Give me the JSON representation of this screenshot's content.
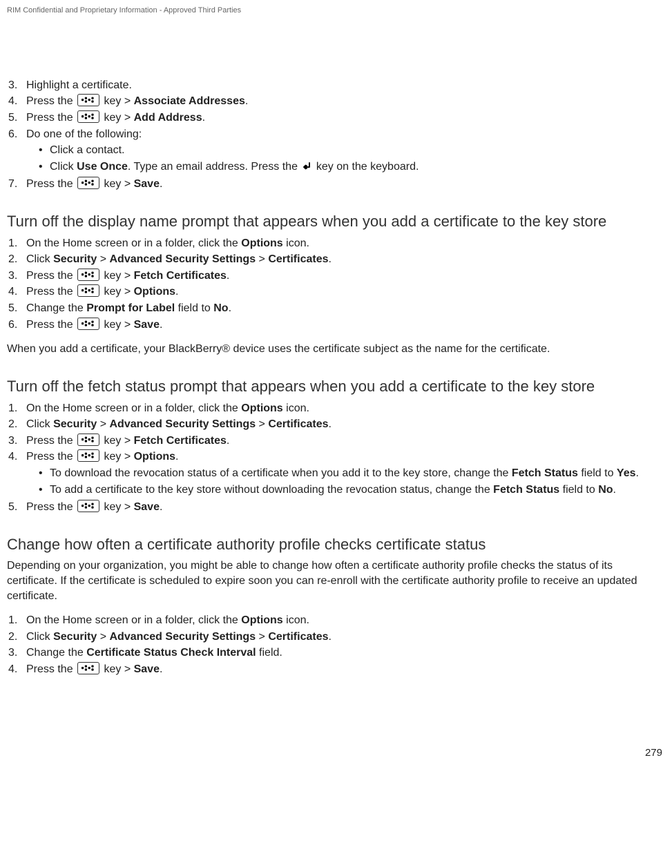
{
  "header": {
    "confidential": "RIM Confidential and Proprietary Information - Approved Third Parties"
  },
  "intro_list": {
    "i3": {
      "num": "3.",
      "text": "Highlight a certificate."
    },
    "i4": {
      "num": "4.",
      "pre": "Press the ",
      "post": " key > ",
      "bold": "Associate Addresses",
      "tail": "."
    },
    "i5": {
      "num": "5.",
      "pre": "Press the ",
      "post": " key > ",
      "bold": "Add Address",
      "tail": "."
    },
    "i6": {
      "num": "6.",
      "text": "Do one of the following:",
      "b1": "Click a contact.",
      "b2_pre": "Click ",
      "b2_bold": "Use Once",
      "b2_mid": ". Type an email address. Press the ",
      "b2_post": " key on the keyboard."
    },
    "i7": {
      "num": "7.",
      "pre": "Press the ",
      "post": " key > ",
      "bold": "Save",
      "tail": "."
    }
  },
  "sec1": {
    "title": "Turn off the display name prompt that appears when you add a certificate to the key store",
    "s1": {
      "num": "1.",
      "pre": "On the Home screen or in a folder, click the ",
      "bold": "Options",
      "tail": " icon."
    },
    "s2": {
      "num": "2.",
      "pre": "Click ",
      "b1": "Security",
      "g1": " > ",
      "b2": "Advanced Security Settings",
      "g2": " > ",
      "b3": "Certificates",
      "tail": "."
    },
    "s3": {
      "num": "3.",
      "pre": "Press the ",
      "post": " key > ",
      "bold": "Fetch Certificates",
      "tail": "."
    },
    "s4": {
      "num": "4.",
      "pre": "Press the ",
      "post": " key > ",
      "bold": "Options",
      "tail": "."
    },
    "s5": {
      "num": "5.",
      "pre": "Change the ",
      "bold": "Prompt for Label",
      "mid": " field to ",
      "bold2": "No",
      "tail": "."
    },
    "s6": {
      "num": "6.",
      "pre": "Press the ",
      "post": " key > ",
      "bold": "Save",
      "tail": "."
    },
    "para": "When you add a certificate, your BlackBerry® device uses the certificate subject as the name for the certificate."
  },
  "sec2": {
    "title": "Turn off the fetch status prompt that appears when you add a certificate to the key store",
    "s1": {
      "num": "1.",
      "pre": "On the Home screen or in a folder, click the ",
      "bold": "Options",
      "tail": " icon."
    },
    "s2": {
      "num": "2.",
      "pre": "Click ",
      "b1": "Security",
      "g1": " > ",
      "b2": "Advanced Security Settings",
      "g2": " > ",
      "b3": "Certificates",
      "tail": "."
    },
    "s3": {
      "num": "3.",
      "pre": "Press the ",
      "post": " key > ",
      "bold": "Fetch Certificates",
      "tail": "."
    },
    "s4": {
      "num": "4.",
      "pre": "Press the ",
      "post": " key > ",
      "bold": "Options",
      "tail": ".",
      "b1_pre": "To download the revocation status of a certificate when you add it to the key store, change the ",
      "b1_bold": "Fetch Status",
      "b1_mid": " field to ",
      "b1_bold2": "Yes",
      "b1_tail": ".",
      "b2_pre": "To add a certificate to the key store without downloading the revocation status, change the ",
      "b2_bold": "Fetch Status",
      "b2_mid": " field to ",
      "b2_bold2": "No",
      "b2_tail": "."
    },
    "s5": {
      "num": "5.",
      "pre": "Press the ",
      "post": " key > ",
      "bold": "Save",
      "tail": "."
    }
  },
  "sec3": {
    "title": "Change how often a certificate authority profile checks certificate status",
    "para": "Depending on your organization, you might be able to change how often a certificate authority profile checks the status of its certificate. If the certificate is scheduled to expire soon you can re-enroll with the certificate authority profile to receive an updated certificate.",
    "s1": {
      "num": "1.",
      "pre": "On the Home screen or in a folder, click the ",
      "bold": "Options",
      "tail": " icon."
    },
    "s2": {
      "num": "2.",
      "pre": "Click ",
      "b1": "Security",
      "g1": " > ",
      "b2": "Advanced Security Settings",
      "g2": " > ",
      "b3": "Certificates",
      "tail": "."
    },
    "s3": {
      "num": "3.",
      "pre": "Change the ",
      "bold": "Certificate Status Check Interval",
      "tail": " field."
    },
    "s4": {
      "num": "4.",
      "pre": "Press the ",
      "post": " key > ",
      "bold": "Save",
      "tail": "."
    }
  },
  "footer": {
    "page": "279"
  }
}
